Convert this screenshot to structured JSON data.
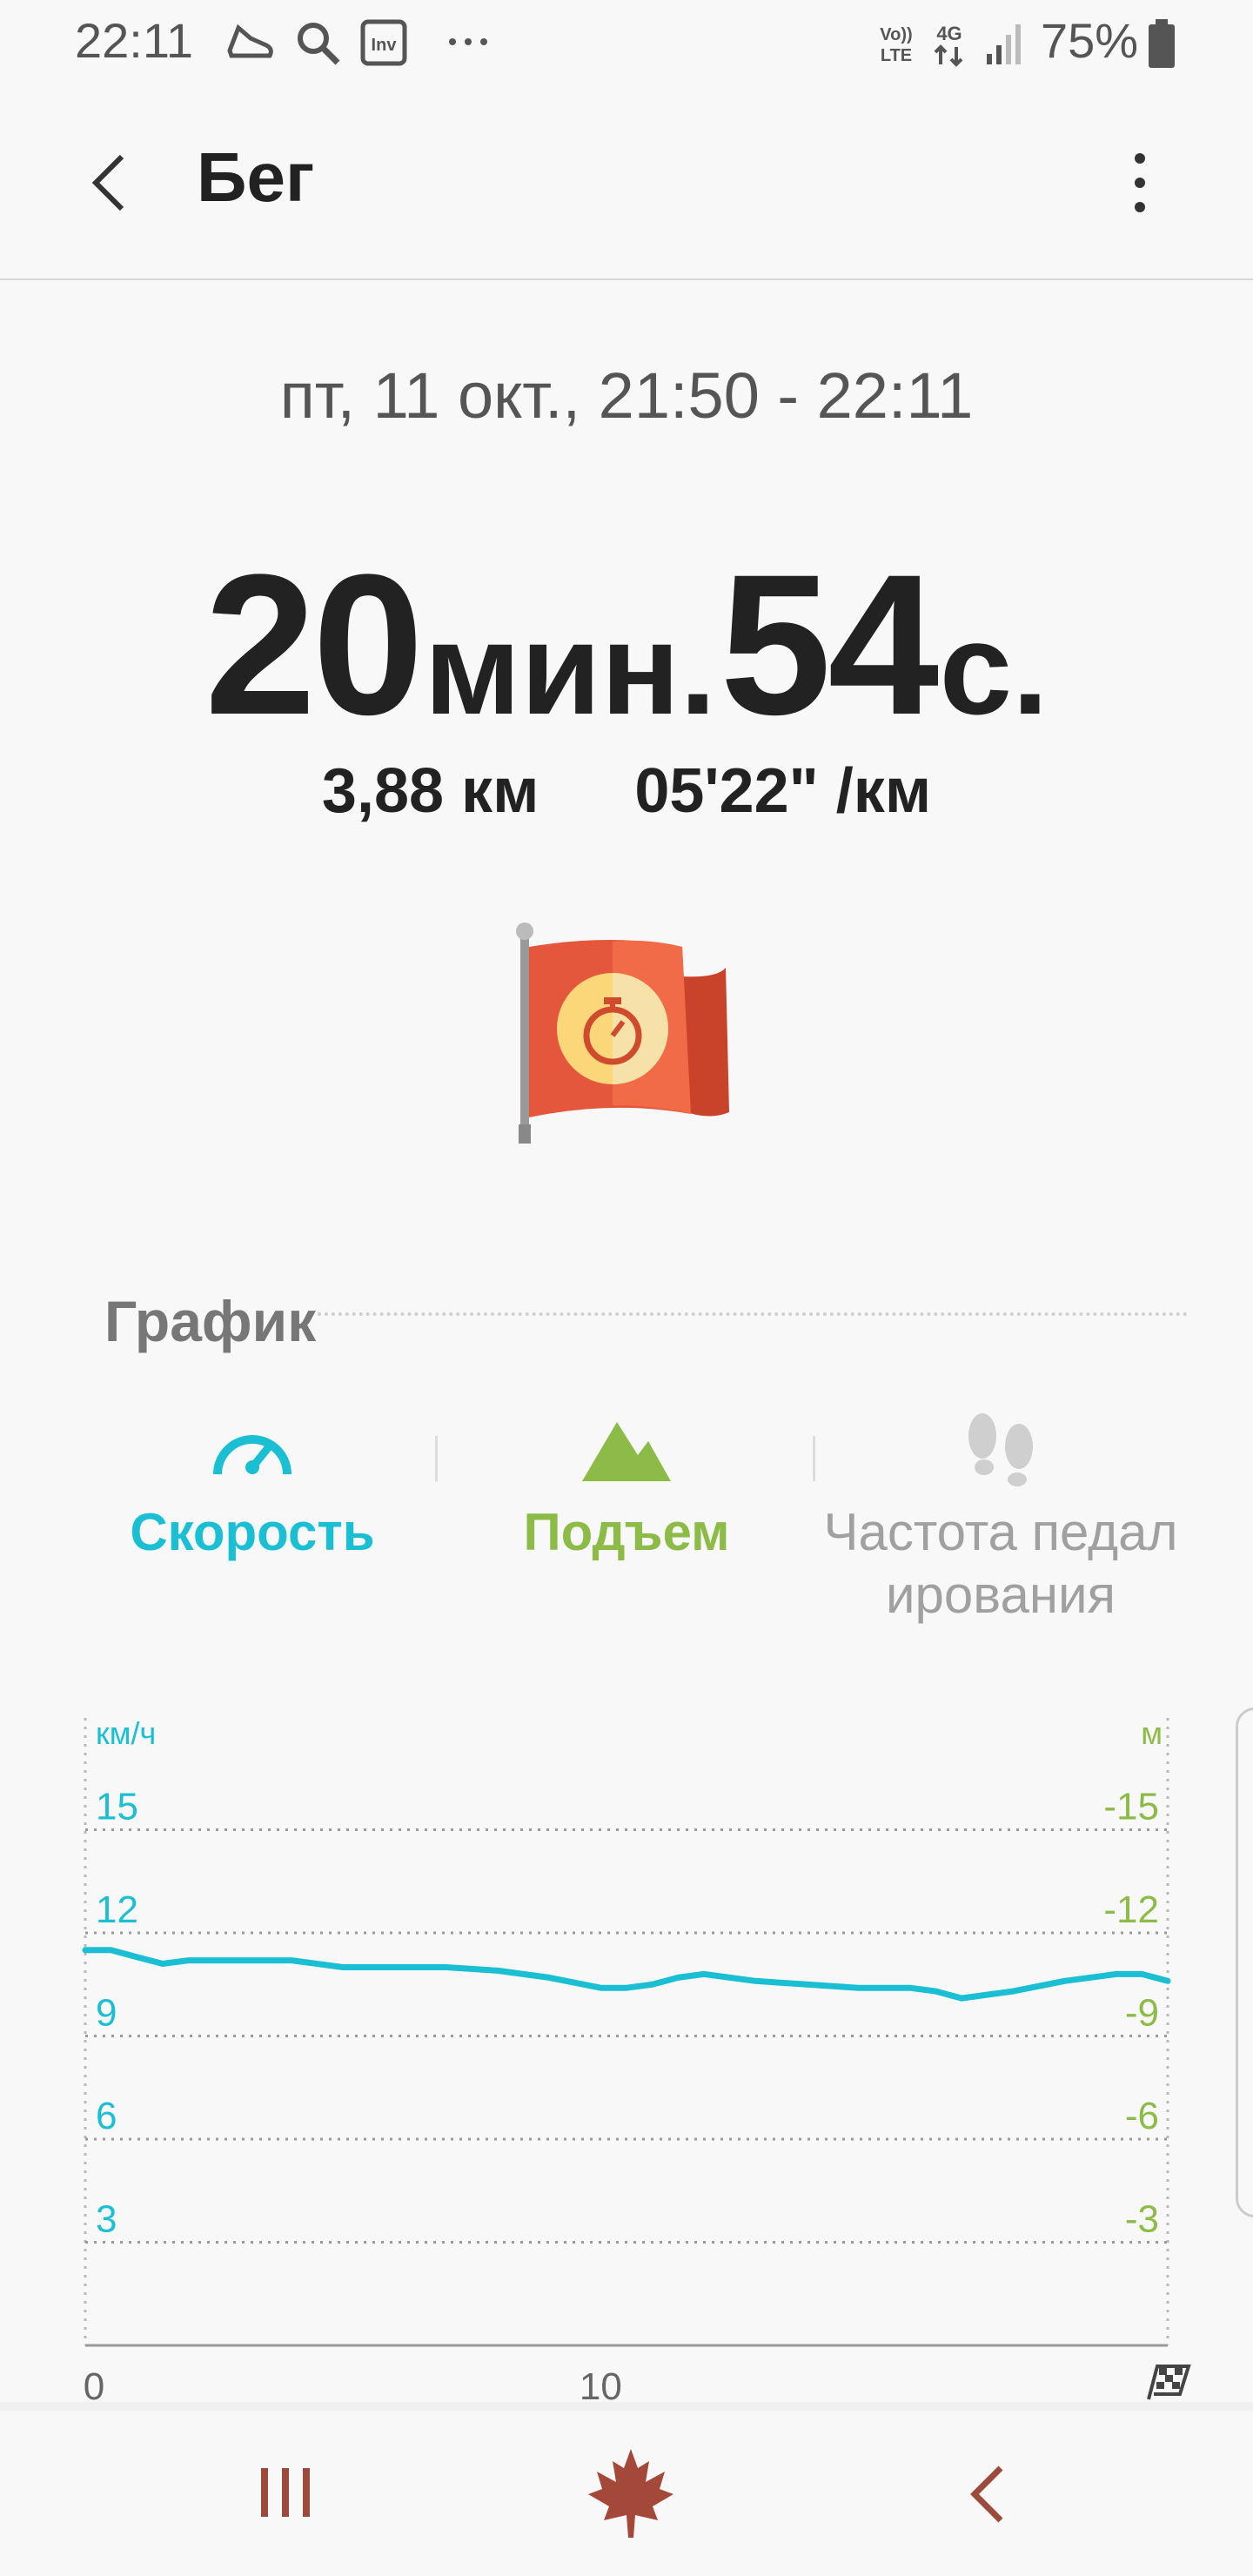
{
  "status_bar": {
    "time": "22:11",
    "battery": "75%",
    "icons": [
      "running-shoe-icon",
      "search-icon",
      "inv-app-icon",
      "more-icon",
      "volte-icon",
      "4g-icon",
      "signal-icon",
      "battery-icon"
    ],
    "volte_label": "Vo)) LTE",
    "network_label": "4G"
  },
  "app_bar": {
    "title": "Бег",
    "back_icon": "back-arrow-icon",
    "menu_icon": "more-vertical-icon"
  },
  "summary": {
    "date_range": "пт, 11 окт., 21:50 - 22:11",
    "duration_minutes": "20",
    "duration_minutes_unit": "мин.",
    "duration_seconds": "54",
    "duration_seconds_unit": "с.",
    "distance": "3,88 км",
    "pace": "05'22\" /км",
    "badge_icon": "flag-stopwatch-badge-icon"
  },
  "graph": {
    "heading": "График",
    "tabs": [
      {
        "label": "Скорость",
        "icon": "speedometer-icon",
        "color": "#1bbfd3",
        "selected": true
      },
      {
        "label": "Подъем",
        "icon": "mountain-icon",
        "color": "#8cbc47",
        "selected": false
      },
      {
        "label_line1": "Частота педал",
        "label_line2": "ирования",
        "icon": "footsteps-icon",
        "color": "#a0a0a0",
        "selected": false
      }
    ]
  },
  "chart_data": {
    "type": "line",
    "left_axis_label": "км/ч",
    "right_axis_label": "м",
    "left_ticks": [
      "15",
      "12",
      "9",
      "6",
      "3"
    ],
    "right_ticks": [
      "-15",
      "-12",
      "-9",
      "-6",
      "-3"
    ],
    "left_color": "#1bbfd3",
    "right_color": "#8cbc47",
    "x_ticks": [
      "0",
      "10"
    ],
    "finish_icon": "checkered-flag-icon",
    "ylim": [
      0,
      18
    ],
    "xlim": [
      0,
      21
    ],
    "series": [
      {
        "x": [
          0,
          0.5,
          1,
          1.5,
          2,
          3,
          4,
          5,
          6,
          7,
          8,
          9,
          10,
          10.5,
          11,
          11.5,
          12,
          13,
          14,
          15,
          15.5,
          16,
          16.5,
          17,
          18,
          19,
          20,
          20.5,
          21
        ],
        "values": [
          11.5,
          11.5,
          11.3,
          11.1,
          11.2,
          11.2,
          11.2,
          11.0,
          11.0,
          11.0,
          10.9,
          10.7,
          10.4,
          10.4,
          10.5,
          10.7,
          10.8,
          10.6,
          10.5,
          10.4,
          10.4,
          10.4,
          10.3,
          10.1,
          10.3,
          10.6,
          10.8,
          10.8,
          10.6
        ]
      }
    ]
  },
  "nav_bar": {
    "recents_icon": "recents-icon",
    "home_icon": "maple-leaf-home-icon",
    "back_icon": "nav-back-icon"
  }
}
